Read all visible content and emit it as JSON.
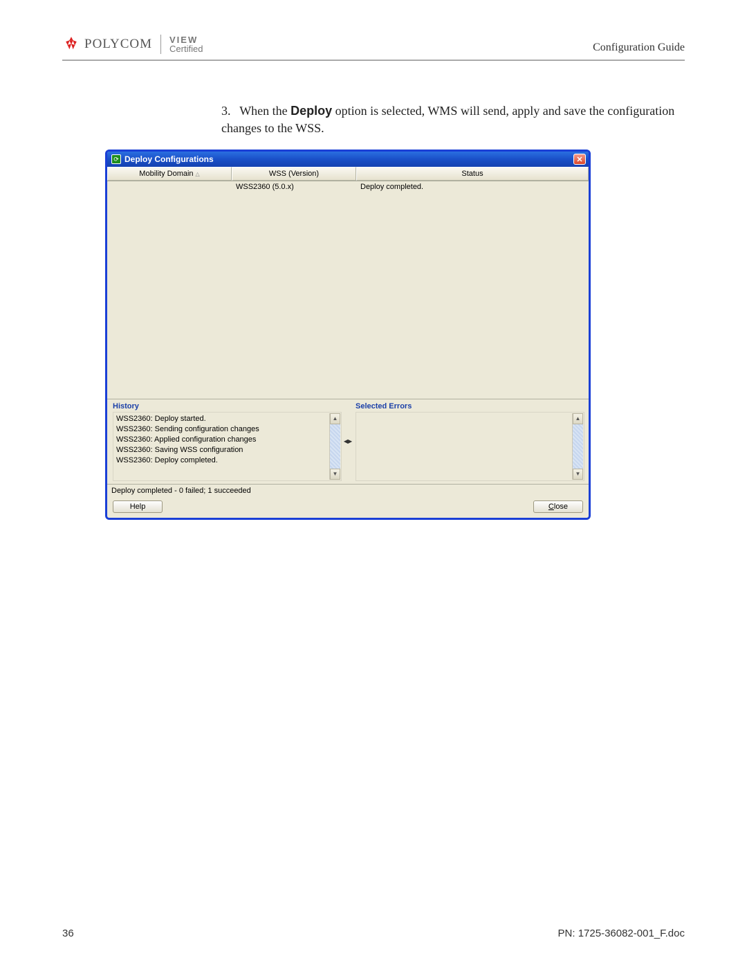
{
  "header": {
    "brand": "POLYCOM",
    "sub1": "VIEW",
    "sub2": "Certified",
    "guide": "Configuration Guide"
  },
  "step": {
    "num": "3.",
    "pre": "When the ",
    "bold": "Deploy",
    "post": " option is selected, WMS will send, apply and save the configuration changes to the WSS."
  },
  "dialog": {
    "title": "Deploy Configurations",
    "columns": {
      "c1": "Mobility Domain",
      "c2": "WSS (Version)",
      "c3": "Status"
    },
    "row": {
      "c1": "",
      "c2": "WSS2360 (5.0.x)",
      "c3": "Deploy completed."
    },
    "history": {
      "title": "History",
      "lines": [
        "WSS2360: Deploy started.",
        "WSS2360: Sending configuration changes",
        "WSS2360: Applied configuration changes",
        "WSS2360: Saving WSS configuration",
        "WSS2360: Deploy completed."
      ]
    },
    "errors": {
      "title": "Selected Errors"
    },
    "status": "Deploy completed - 0 failed; 1 succeeded",
    "help": "Help",
    "close_pre": "",
    "close_u": "C",
    "close_post": "lose"
  },
  "footer": {
    "page": "36",
    "pn": "PN: 1725-36082-001_F.doc"
  }
}
